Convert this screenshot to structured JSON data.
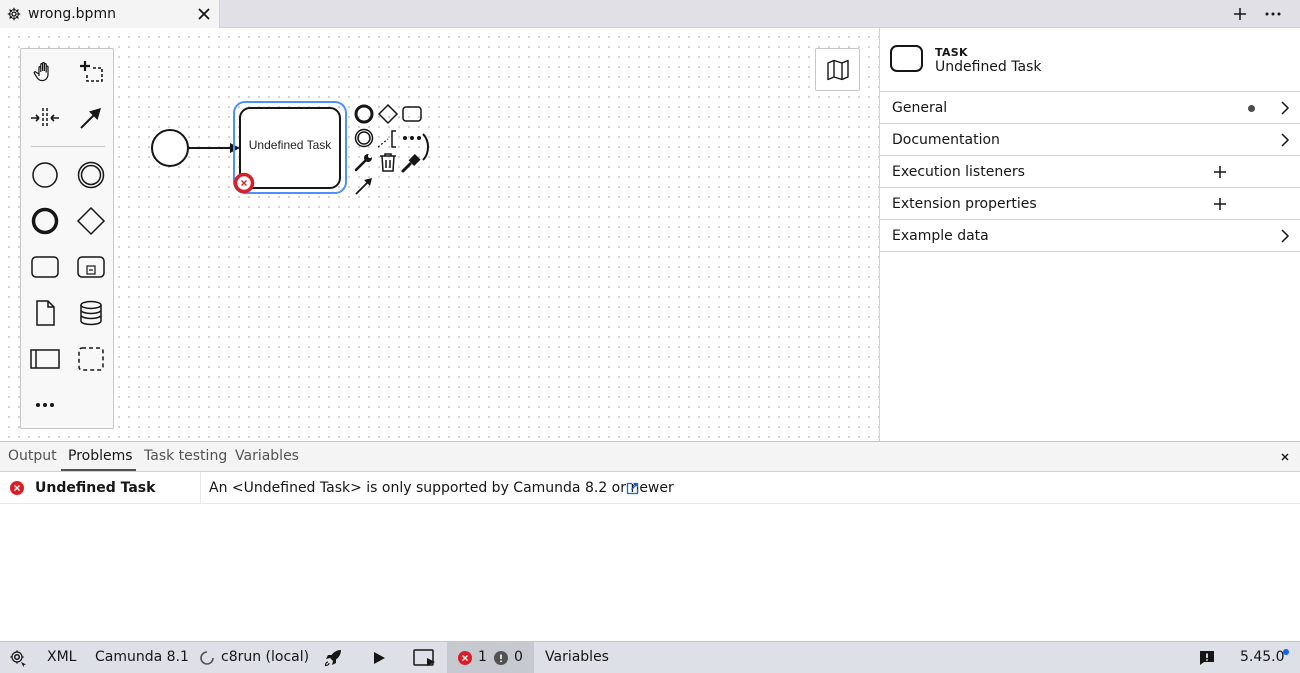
{
  "tab": {
    "title": "wrong.bpmn",
    "icons": {
      "file": "gear-icon",
      "close": "close-icon"
    }
  },
  "tabbar_actions": {
    "add": "plus-icon",
    "more": "more-horizontal-icon"
  },
  "palette": {
    "tools": [
      "hand-tool-icon",
      "lasso-tool-icon",
      "space-tool-icon",
      "global-connect-icon",
      "start-event-icon",
      "intermediate-event-icon",
      "end-event-icon",
      "gateway-icon",
      "task-icon",
      "subprocess-icon",
      "data-object-icon",
      "data-store-icon",
      "participant-icon",
      "group-icon",
      "more-icon"
    ]
  },
  "canvas": {
    "task_label": "Undefined Task",
    "minimap_icon": "map-icon"
  },
  "properties": {
    "element_type": "TASK",
    "element_name": "Undefined Task",
    "groups": [
      {
        "label": "General",
        "action": "chevron",
        "has_dot": true
      },
      {
        "label": "Documentation",
        "action": "chevron",
        "has_dot": false
      },
      {
        "label": "Execution listeners",
        "action": "plus",
        "has_dot": false
      },
      {
        "label": "Extension properties",
        "action": "plus",
        "has_dot": false
      },
      {
        "label": "Example data",
        "action": "chevron",
        "has_dot": false
      }
    ]
  },
  "bottom_panel": {
    "tabs": [
      "Output",
      "Problems",
      "Task testing",
      "Variables"
    ],
    "active_tab": "Problems",
    "problems": [
      {
        "element": "Undefined Task",
        "message": "An <Undefined Task> is only supported by Camunda 8.2 or newer",
        "severity": "error"
      }
    ]
  },
  "status_bar": {
    "xml_label": "XML",
    "engine_label": "Camunda 8.1",
    "connection_label": "c8run (local)",
    "error_count": "1",
    "warning_count": "0",
    "variables_label": "Variables",
    "version": "5.45.0"
  },
  "colors": {
    "selection": "#4d90ff",
    "error": "#da1e28",
    "accent": "#0f62fe"
  }
}
